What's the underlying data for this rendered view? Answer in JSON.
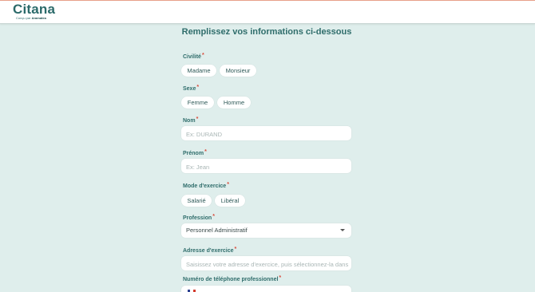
{
  "header": {
    "logo_text": "Citana",
    "logo_tagline_prefix": "Conçu par",
    "logo_tagline_brand": "Aramatea"
  },
  "form": {
    "title": "Remplissez vos informations ci-dessous",
    "required_mark": "*",
    "civilite": {
      "label": "Civilité",
      "options": [
        "Madame",
        "Monsieur"
      ]
    },
    "sexe": {
      "label": "Sexe",
      "options": [
        "Femme",
        "Homme"
      ]
    },
    "nom": {
      "label": "Nom",
      "placeholder": "Ex: DURAND"
    },
    "prenom": {
      "label": "Prénom",
      "placeholder": "Ex: Jean"
    },
    "mode_exercice": {
      "label": "Mode d'exercice",
      "options": [
        "Salarié",
        "Libéral"
      ]
    },
    "profession": {
      "label": "Profession",
      "value": "Personnel Administratif"
    },
    "adresse": {
      "label": "Adresse d'exercice",
      "placeholder": "Saisissez votre adresse d'exercice, puis sélectionnez-la dans"
    },
    "telephone": {
      "label": "Numéro de téléphone professionnel",
      "flag_colors": [
        "#2a3f8f",
        "#ffffff",
        "#d33a2c"
      ]
    }
  },
  "colors": {
    "background": "#dfeeec",
    "accent": "#2f6d6b",
    "required": "#d94a3a"
  }
}
